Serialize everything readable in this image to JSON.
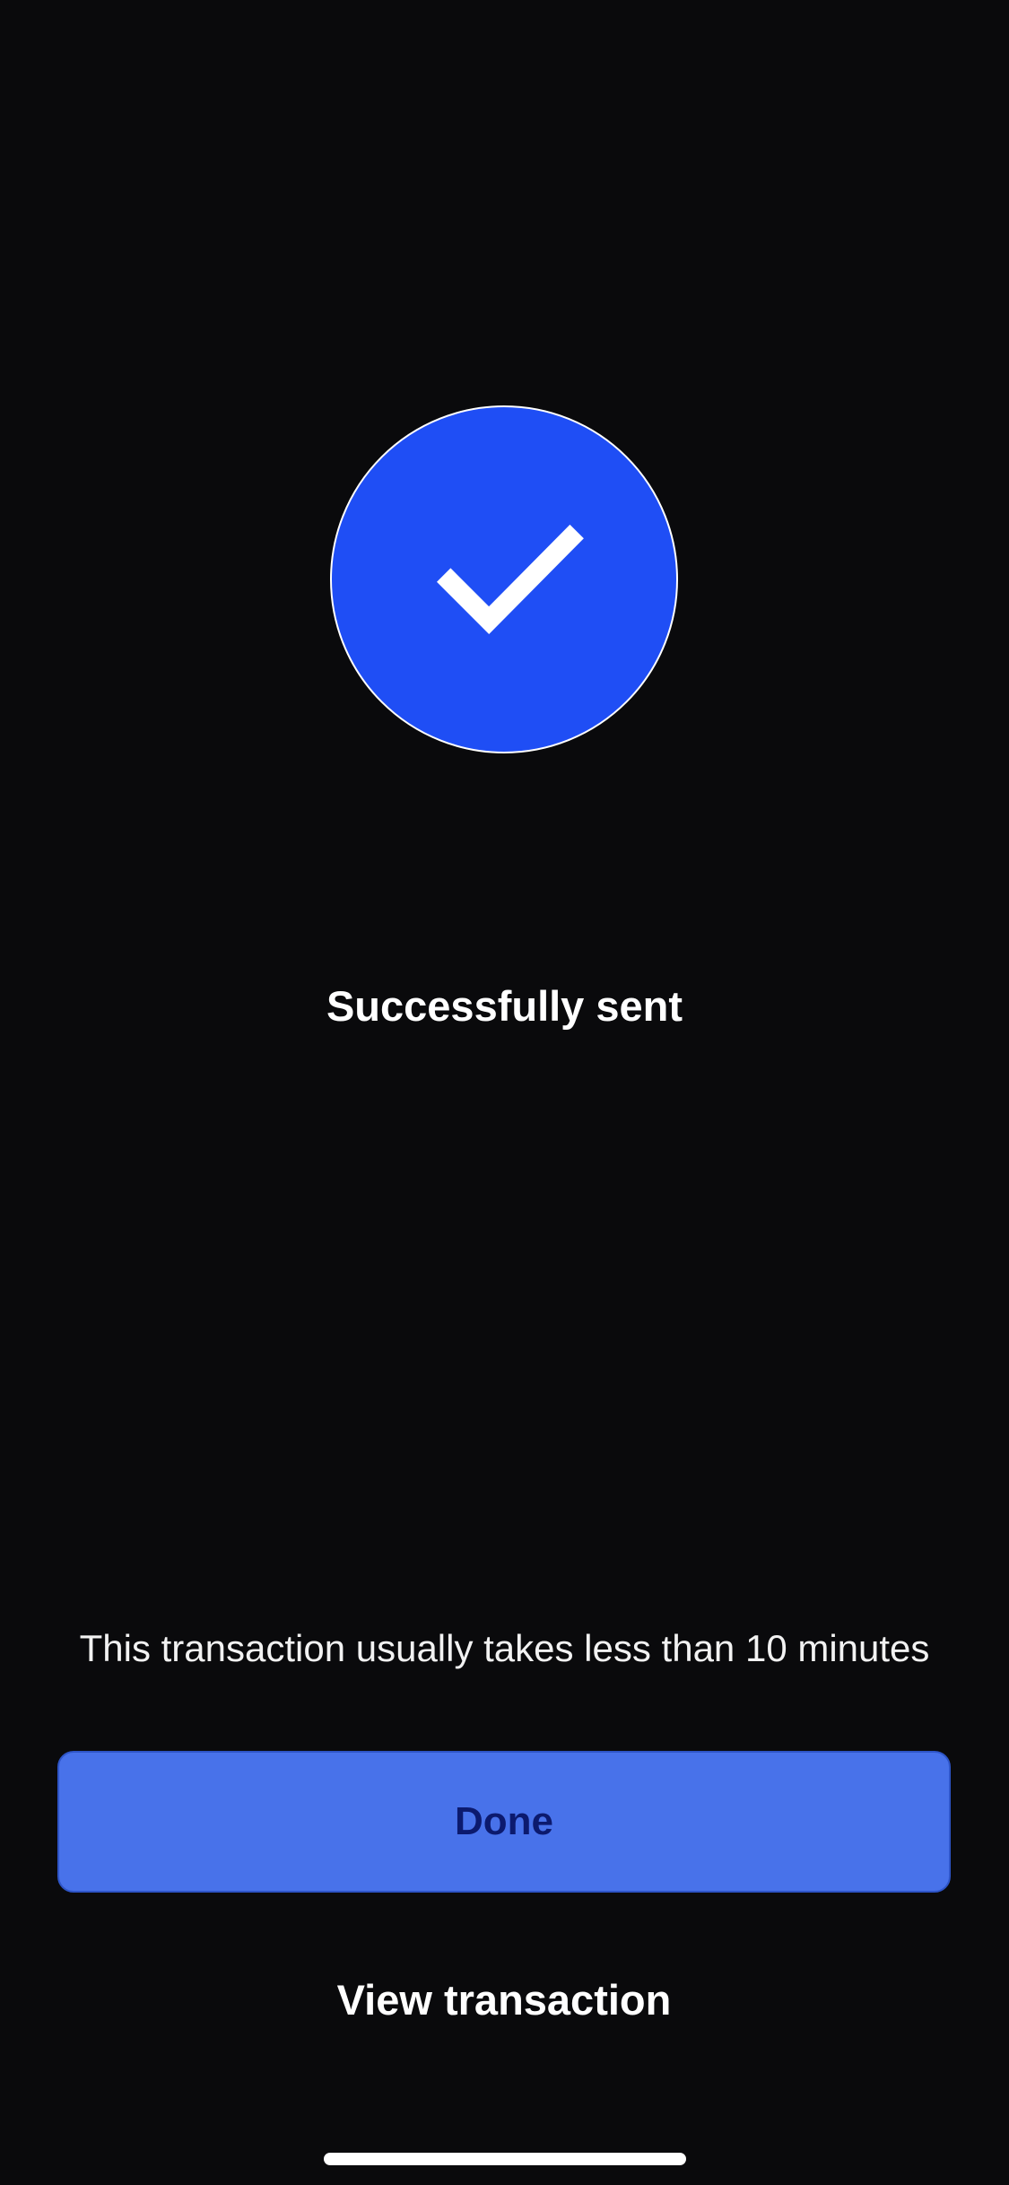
{
  "success": {
    "icon": "checkmark-icon",
    "accent_color": "#1f4ef5",
    "title": "Successfully sent"
  },
  "info": {
    "text": "This transaction usually takes less than 10 minutes"
  },
  "actions": {
    "done_label": "Done",
    "done_color": "#4872ea",
    "view_transaction_label": "View transaction"
  }
}
